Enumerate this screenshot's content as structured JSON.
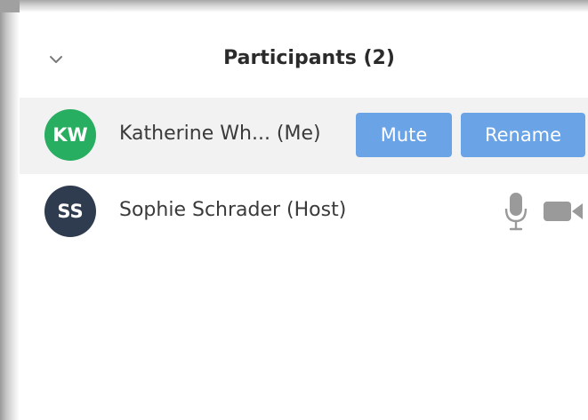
{
  "panel": {
    "title": "Participants (2)"
  },
  "participants": [
    {
      "initials": "KW",
      "name": "Katherine Wh... (Me)",
      "avatar_color": "#27ae60",
      "mute_label": "Mute",
      "rename_label": "Rename"
    },
    {
      "initials": "SS",
      "name": "Sophie Schrader (Host)",
      "avatar_color": "#2f3b4f",
      "icons": [
        "microphone-icon",
        "video-camera-icon"
      ]
    }
  ],
  "colors": {
    "button_blue": "#6aa3e6",
    "selected_row": "#f2f2f2",
    "icon_gray": "#9a9a9a"
  }
}
